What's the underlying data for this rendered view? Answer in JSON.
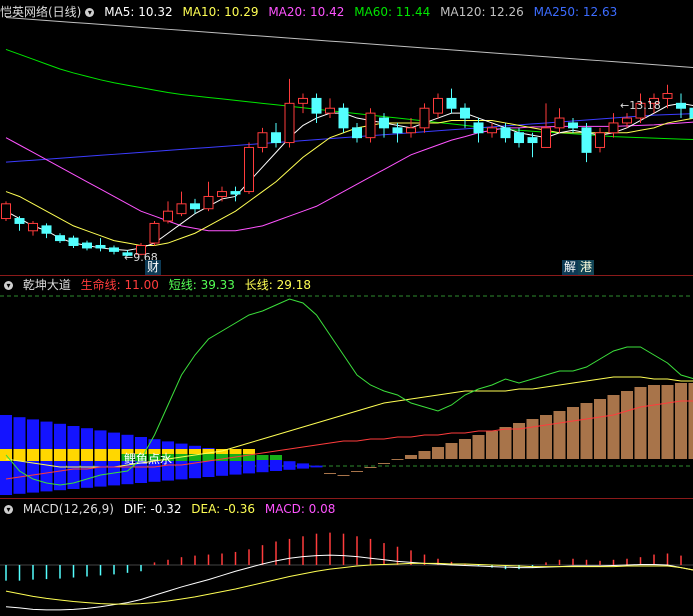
{
  "header1": {
    "title": "恺英网络(日线)",
    "ma5": "MA5: 10.32",
    "ma10": "MA10: 10.29",
    "ma20": "MA20: 10.42",
    "ma60": "MA60: 11.44",
    "ma120": "MA120: 12.26",
    "ma250": "MA250: 12.63"
  },
  "header2": {
    "title": "乾坤大道",
    "life": "生命线: 11.00",
    "short": "短线: 39.33",
    "long": "长线: 29.18"
  },
  "header3": {
    "title": "MACD(12,26,9)",
    "dif": "DIF: -0.32",
    "dea": "DEA: -0.36",
    "macd": "MACD: 0.08"
  },
  "annotations": {
    "high_label": "13.18",
    "low_label": "9.68",
    "cai": "财",
    "jie": "解",
    "gang": "港",
    "signal": "鲤鱼点水"
  },
  "colors": {
    "up": "#ff3c3c",
    "down": "#54ffff",
    "ma5": "#ffffff",
    "ma10": "#ffff54",
    "ma20": "#ff54ff",
    "ma60": "#00e600",
    "ma120": "#c0c0c0",
    "ma250": "#3c3cff"
  },
  "chart_data": [
    {
      "type": "candlestick",
      "title": "恺英网络(日线)",
      "ylim": [
        9.4,
        14.5
      ],
      "candles": [
        [
          10.45,
          10.75,
          10.8,
          10.4
        ],
        [
          10.45,
          10.35,
          10.5,
          10.2
        ],
        [
          10.2,
          10.35,
          10.4,
          10.1
        ],
        [
          10.3,
          10.15,
          10.35,
          10.05
        ],
        [
          10.1,
          10.0,
          10.15,
          9.95
        ],
        [
          10.05,
          9.9,
          10.1,
          9.85
        ],
        [
          9.95,
          9.85,
          10.0,
          9.8
        ],
        [
          9.9,
          9.85,
          10.05,
          9.78
        ],
        [
          9.85,
          9.78,
          9.9,
          9.72
        ],
        [
          9.75,
          9.7,
          9.8,
          9.68
        ],
        [
          9.72,
          9.9,
          9.95,
          9.7
        ],
        [
          9.95,
          10.35,
          10.4,
          9.9
        ],
        [
          10.4,
          10.6,
          10.8,
          10.35
        ],
        [
          10.55,
          10.75,
          11.0,
          10.5
        ],
        [
          10.75,
          10.65,
          10.85,
          10.55
        ],
        [
          10.65,
          10.9,
          11.2,
          10.6
        ],
        [
          10.9,
          11.0,
          11.1,
          10.8
        ],
        [
          11.0,
          10.95,
          11.1,
          10.8
        ],
        [
          11.0,
          11.9,
          12.0,
          10.95
        ],
        [
          11.9,
          12.2,
          12.3,
          11.8
        ],
        [
          12.2,
          12.0,
          12.4,
          11.9
        ],
        [
          12.0,
          12.8,
          13.3,
          11.9
        ],
        [
          12.8,
          12.9,
          13.0,
          12.6
        ],
        [
          12.9,
          12.6,
          13.0,
          12.4
        ],
        [
          12.6,
          12.7,
          12.9,
          12.5
        ],
        [
          12.7,
          12.3,
          12.8,
          12.2
        ],
        [
          12.3,
          12.1,
          12.4,
          12.0
        ],
        [
          12.1,
          12.6,
          12.7,
          12.0
        ],
        [
          12.5,
          12.3,
          12.6,
          12.1
        ],
        [
          12.3,
          12.2,
          12.4,
          12.0
        ],
        [
          12.2,
          12.3,
          12.5,
          12.1
        ],
        [
          12.3,
          12.7,
          12.8,
          12.2
        ],
        [
          12.6,
          12.9,
          13.0,
          12.5
        ],
        [
          12.9,
          12.7,
          13.1,
          12.6
        ],
        [
          12.7,
          12.5,
          12.8,
          12.3
        ],
        [
          12.4,
          12.2,
          12.5,
          12.0
        ],
        [
          12.2,
          12.3,
          12.4,
          12.1
        ],
        [
          12.3,
          12.1,
          12.4,
          12.0
        ],
        [
          12.2,
          12.0,
          12.3,
          11.9
        ],
        [
          12.1,
          12.0,
          12.2,
          11.7
        ],
        [
          11.9,
          12.3,
          12.8,
          11.9
        ],
        [
          12.3,
          12.5,
          12.7,
          12.2
        ],
        [
          12.4,
          12.3,
          12.5,
          12.2
        ],
        [
          12.3,
          11.8,
          12.4,
          11.6
        ],
        [
          11.9,
          12.2,
          12.3,
          11.8
        ],
        [
          12.2,
          12.4,
          12.6,
          12.1
        ],
        [
          12.4,
          12.5,
          12.6,
          12.3
        ],
        [
          12.5,
          12.8,
          13.0,
          12.4
        ],
        [
          12.8,
          12.9,
          13.0,
          12.6
        ],
        [
          12.9,
          13.0,
          13.18,
          12.7
        ],
        [
          12.8,
          12.7,
          13.0,
          12.5
        ],
        [
          12.7,
          12.5,
          12.8,
          12.4
        ],
        [
          12.5,
          12.3,
          12.6,
          12.2
        ],
        [
          12.3,
          12.2,
          12.4,
          12.0
        ],
        [
          12.2,
          12.4,
          12.5,
          12.1
        ]
      ],
      "ma": {
        "ma5": [
          10.6,
          10.45,
          10.3,
          10.2,
          10.05,
          9.95,
          9.9,
          9.85,
          9.82,
          9.8,
          9.85,
          9.95,
          10.15,
          10.35,
          10.55,
          10.7,
          10.85,
          10.9,
          11.2,
          11.5,
          11.8,
          12.1,
          12.35,
          12.5,
          12.6,
          12.6,
          12.5,
          12.45,
          12.4,
          12.35,
          12.3,
          12.4,
          12.5,
          12.6,
          12.6,
          12.5,
          12.4,
          12.3,
          12.2,
          12.15,
          12.1,
          12.2,
          12.25,
          12.2,
          12.15,
          12.2,
          12.3,
          12.45,
          12.6,
          12.75,
          12.8,
          12.75,
          12.6,
          12.45,
          12.35
        ],
        "ma10": [
          11.0,
          10.9,
          10.75,
          10.6,
          10.45,
          10.3,
          10.2,
          10.1,
          10.0,
          9.95,
          9.9,
          9.9,
          9.95,
          10.05,
          10.15,
          10.3,
          10.45,
          10.6,
          10.8,
          11.0,
          11.2,
          11.45,
          11.7,
          11.9,
          12.1,
          12.2,
          12.3,
          12.35,
          12.4,
          12.4,
          12.4,
          12.4,
          12.4,
          12.45,
          12.45,
          12.45,
          12.45,
          12.4,
          12.35,
          12.3,
          12.25,
          12.2,
          12.2,
          12.2,
          12.2,
          12.2,
          12.2,
          12.25,
          12.3,
          12.4,
          12.45,
          12.5,
          12.55,
          12.55,
          12.5
        ],
        "ma20": [
          12.1,
          11.95,
          11.8,
          11.65,
          11.5,
          11.35,
          11.2,
          11.05,
          10.9,
          10.75,
          10.6,
          10.5,
          10.4,
          10.3,
          10.25,
          10.2,
          10.2,
          10.2,
          10.25,
          10.3,
          10.4,
          10.5,
          10.6,
          10.7,
          10.85,
          11.0,
          11.15,
          11.3,
          11.45,
          11.6,
          11.75,
          11.85,
          11.95,
          12.05,
          12.12,
          12.2,
          12.25,
          12.3,
          12.3,
          12.32,
          12.32,
          12.33,
          12.33,
          12.33,
          12.33,
          12.33,
          12.34,
          12.35,
          12.36,
          12.38,
          12.4,
          12.42,
          12.44,
          12.46,
          12.47
        ],
        "ma60": [
          13.9,
          13.8,
          13.7,
          13.6,
          13.5,
          13.42,
          13.35,
          13.28,
          13.22,
          13.17,
          13.12,
          13.07,
          13.02,
          12.98,
          12.95,
          12.92,
          12.89,
          12.86,
          12.83,
          12.8,
          12.77,
          12.74,
          12.71,
          12.68,
          12.65,
          12.62,
          12.59,
          12.56,
          12.53,
          12.5,
          12.47,
          12.44,
          12.41,
          12.38,
          12.35,
          12.32,
          12.29,
          12.27,
          12.25,
          12.23,
          12.21,
          12.2,
          12.18,
          12.16,
          12.14,
          12.12,
          12.11,
          12.1,
          12.09,
          12.08,
          12.07,
          12.06,
          12.05,
          12.05,
          12.05
        ],
        "ma120": [
          14.55,
          14.53,
          14.51,
          14.49,
          14.47,
          14.45,
          14.43,
          14.41,
          14.39,
          14.37,
          14.35,
          14.33,
          14.31,
          14.29,
          14.27,
          14.25,
          14.23,
          14.21,
          14.19,
          14.17,
          14.15,
          14.13,
          14.11,
          14.09,
          14.07,
          14.05,
          14.03,
          14.01,
          13.99,
          13.97,
          13.95,
          13.93,
          13.91,
          13.89,
          13.87,
          13.85,
          13.83,
          13.81,
          13.79,
          13.77,
          13.75,
          13.73,
          13.71,
          13.69,
          13.67,
          13.65,
          13.63,
          13.61,
          13.59,
          13.57,
          13.55,
          13.53,
          13.51,
          13.49,
          13.47
        ],
        "ma250": [
          11.6,
          11.62,
          11.64,
          11.66,
          11.68,
          11.7,
          11.72,
          11.74,
          11.76,
          11.78,
          11.8,
          11.82,
          11.84,
          11.86,
          11.88,
          11.9,
          11.92,
          11.94,
          11.96,
          11.98,
          12.0,
          12.02,
          12.04,
          12.06,
          12.08,
          12.1,
          12.12,
          12.14,
          12.16,
          12.18,
          12.2,
          12.22,
          12.24,
          12.26,
          12.28,
          12.3,
          12.32,
          12.34,
          12.36,
          12.38,
          12.4,
          12.42,
          12.44,
          12.46,
          12.48,
          12.5,
          12.52,
          12.54,
          12.56,
          12.57,
          12.58,
          12.59,
          12.6,
          12.62,
          12.63
        ]
      }
    },
    {
      "type": "bar",
      "title": "乾坤大道",
      "ylim": [
        0,
        100
      ],
      "bar_tops": [
        40,
        39,
        38,
        37,
        36,
        35,
        34,
        33,
        32,
        31,
        30,
        29,
        28,
        27,
        26,
        25,
        24,
        23,
        22,
        21,
        19,
        17,
        15,
        13,
        11,
        10,
        12,
        14,
        16,
        18,
        20,
        22,
        24,
        26,
        28,
        30,
        32,
        34,
        36,
        38,
        40,
        42,
        44,
        46,
        48,
        50,
        52,
        54,
        55,
        55,
        56,
        56,
        55,
        54,
        53
      ],
      "life": [
        8,
        9,
        10,
        11,
        12,
        13,
        13,
        14,
        14,
        14,
        14,
        14,
        15,
        15,
        16,
        17,
        18,
        19,
        20,
        21,
        22,
        23,
        24,
        25,
        26,
        27,
        27,
        28,
        28,
        29,
        29,
        30,
        30,
        31,
        31,
        32,
        32,
        33,
        33,
        34,
        35,
        36,
        37,
        38,
        39,
        40,
        42,
        44,
        45,
        46,
        47,
        47,
        48,
        48,
        47
      ],
      "short": [
        20,
        12,
        8,
        6,
        5,
        6,
        8,
        10,
        11,
        12,
        18,
        30,
        45,
        60,
        70,
        78,
        82,
        86,
        90,
        92,
        95,
        98,
        96,
        90,
        80,
        70,
        60,
        55,
        52,
        50,
        46,
        44,
        42,
        45,
        50,
        53,
        55,
        58,
        56,
        58,
        60,
        62,
        62,
        64,
        68,
        72,
        74,
        74,
        70,
        66,
        60,
        58,
        55,
        50,
        45
      ],
      "long": [
        18,
        17,
        16,
        15,
        14,
        14,
        14,
        14,
        14,
        15,
        16,
        17,
        18,
        19,
        20,
        21,
        22,
        24,
        26,
        28,
        30,
        32,
        34,
        36,
        38,
        40,
        42,
        44,
        46,
        47,
        48,
        49,
        50,
        51,
        52,
        52,
        52,
        52,
        53,
        53,
        54,
        55,
        56,
        57,
        58,
        59,
        59,
        59,
        58,
        58,
        57,
        57,
        56,
        56,
        55
      ]
    },
    {
      "type": "bar",
      "title": "MACD(12,26,9)",
      "ylim": [
        -0.9,
        0.9
      ],
      "macd": [
        -0.3,
        -0.3,
        -0.28,
        -0.27,
        -0.26,
        -0.24,
        -0.22,
        -0.2,
        -0.18,
        -0.15,
        -0.12,
        0.05,
        0.1,
        0.15,
        0.18,
        0.2,
        0.22,
        0.25,
        0.3,
        0.38,
        0.45,
        0.5,
        0.55,
        0.6,
        0.62,
        0.6,
        0.55,
        0.5,
        0.42,
        0.35,
        0.28,
        0.2,
        0.12,
        0.06,
        0.02,
        -0.02,
        -0.05,
        -0.08,
        -0.08,
        -0.05,
        0.05,
        0.1,
        0.12,
        0.1,
        0.08,
        0.1,
        0.12,
        0.15,
        0.2,
        0.22,
        0.18,
        0.14,
        0.1,
        0.08,
        0.08
      ],
      "dif": [
        -0.8,
        -0.82,
        -0.85,
        -0.86,
        -0.86,
        -0.85,
        -0.83,
        -0.8,
        -0.76,
        -0.72,
        -0.66,
        -0.58,
        -0.5,
        -0.42,
        -0.35,
        -0.28,
        -0.2,
        -0.12,
        -0.05,
        0.02,
        0.08,
        0.13,
        0.16,
        0.18,
        0.19,
        0.18,
        0.16,
        0.13,
        0.1,
        0.07,
        0.05,
        0.03,
        0.02,
        0.0,
        -0.01,
        -0.02,
        -0.03,
        -0.04,
        -0.05,
        -0.05,
        -0.04,
        -0.03,
        -0.02,
        -0.02,
        -0.02,
        -0.01,
        0.0,
        0.01,
        0.01,
        0.0,
        -0.05,
        -0.1,
        -0.15,
        -0.25,
        -0.32
      ],
      "dea": [
        -0.5,
        -0.55,
        -0.6,
        -0.64,
        -0.67,
        -0.7,
        -0.72,
        -0.74,
        -0.75,
        -0.75,
        -0.74,
        -0.72,
        -0.69,
        -0.65,
        -0.61,
        -0.56,
        -0.51,
        -0.46,
        -0.4,
        -0.34,
        -0.28,
        -0.22,
        -0.17,
        -0.12,
        -0.08,
        -0.05,
        -0.02,
        0.0,
        0.01,
        0.02,
        0.03,
        0.03,
        0.03,
        0.02,
        0.02,
        0.01,
        0.0,
        -0.01,
        -0.02,
        -0.03,
        -0.03,
        -0.03,
        -0.03,
        -0.03,
        -0.03,
        -0.03,
        -0.02,
        -0.02,
        -0.02,
        -0.02,
        -0.05,
        -0.1,
        -0.18,
        -0.28,
        -0.36
      ]
    }
  ]
}
